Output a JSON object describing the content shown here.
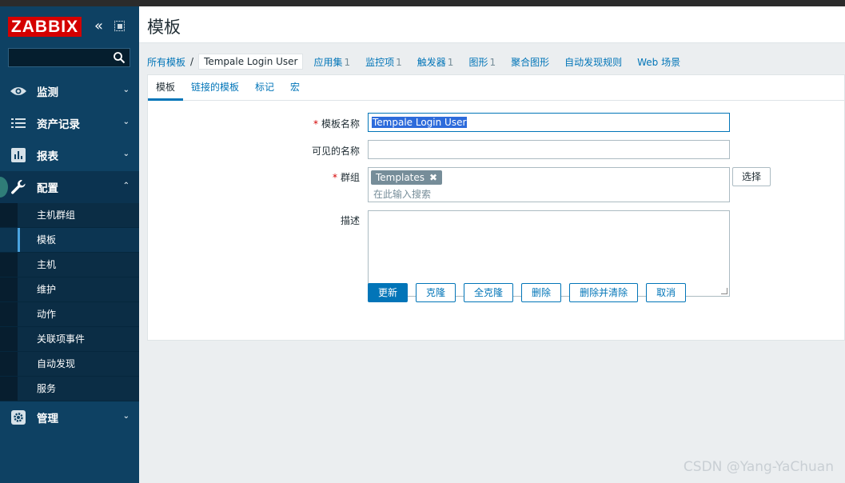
{
  "brand": {
    "logo": "ZABBIX",
    "accent": "#d40000",
    "sidebar_bg": "#0e4163",
    "link_color": "#0275b8"
  },
  "sidebar": {
    "items": [
      {
        "label": "监测",
        "icon": "eye-icon"
      },
      {
        "label": "资产记录",
        "icon": "list-icon"
      },
      {
        "label": "报表",
        "icon": "bar-chart-icon"
      },
      {
        "label": "配置",
        "icon": "wrench-icon"
      },
      {
        "label": "管理",
        "icon": "gear-icon"
      }
    ],
    "config_submenu": [
      "主机群组",
      "模板",
      "主机",
      "维护",
      "动作",
      "关联项事件",
      "自动发现",
      "服务"
    ]
  },
  "header": {
    "title": "模板"
  },
  "breadcrumbs": {
    "all_templates": "所有模板",
    "separator": "/",
    "current": "Tempale Login User",
    "links": [
      {
        "label": "应用集",
        "count": "1"
      },
      {
        "label": "监控项",
        "count": "1"
      },
      {
        "label": "触发器",
        "count": "1"
      },
      {
        "label": "图形",
        "count": "1"
      },
      {
        "label": "聚合图形",
        "count": ""
      },
      {
        "label": "自动发现规则",
        "count": ""
      },
      {
        "label": "Web 场景",
        "count": ""
      }
    ]
  },
  "tabs": [
    "模板",
    "链接的模板",
    "标记",
    "宏"
  ],
  "form": {
    "template_name_label": "模板名称",
    "template_name_value": "Tempale Login User",
    "visible_name_label": "可见的名称",
    "visible_name_value": "",
    "groups_label": "群组",
    "group_tag": "Templates",
    "groups_placeholder": "在此输入搜索",
    "select_button": "选择",
    "description_label": "描述",
    "required_mark": "*"
  },
  "buttons": [
    "更新",
    "克隆",
    "全克隆",
    "删除",
    "删除并清除",
    "取消"
  ],
  "watermark": "CSDN @Yang-YaChuan"
}
